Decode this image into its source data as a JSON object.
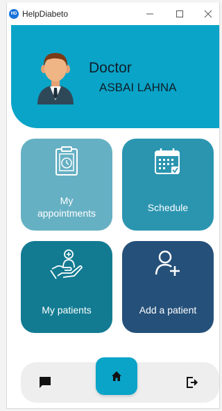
{
  "window": {
    "title": "HelpDiabeto",
    "app_icon_text": "HD",
    "controls": [
      "minimize",
      "maximize",
      "close"
    ]
  },
  "header": {
    "role": "Doctor",
    "name": "ASBAI LAHNA",
    "avatar_icon": "doctor-avatar-icon"
  },
  "tiles": [
    {
      "label_line1": "My",
      "label_line2": "appointments",
      "icon": "clipboard-clock-icon",
      "color": "#66b0c3"
    },
    {
      "label": "Schedule",
      "icon": "calendar-icon",
      "color": "#2b95b0"
    },
    {
      "label": "My patients",
      "icon": "hand-care-icon",
      "color": "#127b92"
    },
    {
      "label": "Add a patient",
      "icon": "add-user-icon",
      "color": "#25507a"
    }
  ],
  "nav": {
    "items": [
      "chat-icon",
      "home-icon",
      "logout-icon"
    ],
    "accent": "#0aa4c8"
  }
}
